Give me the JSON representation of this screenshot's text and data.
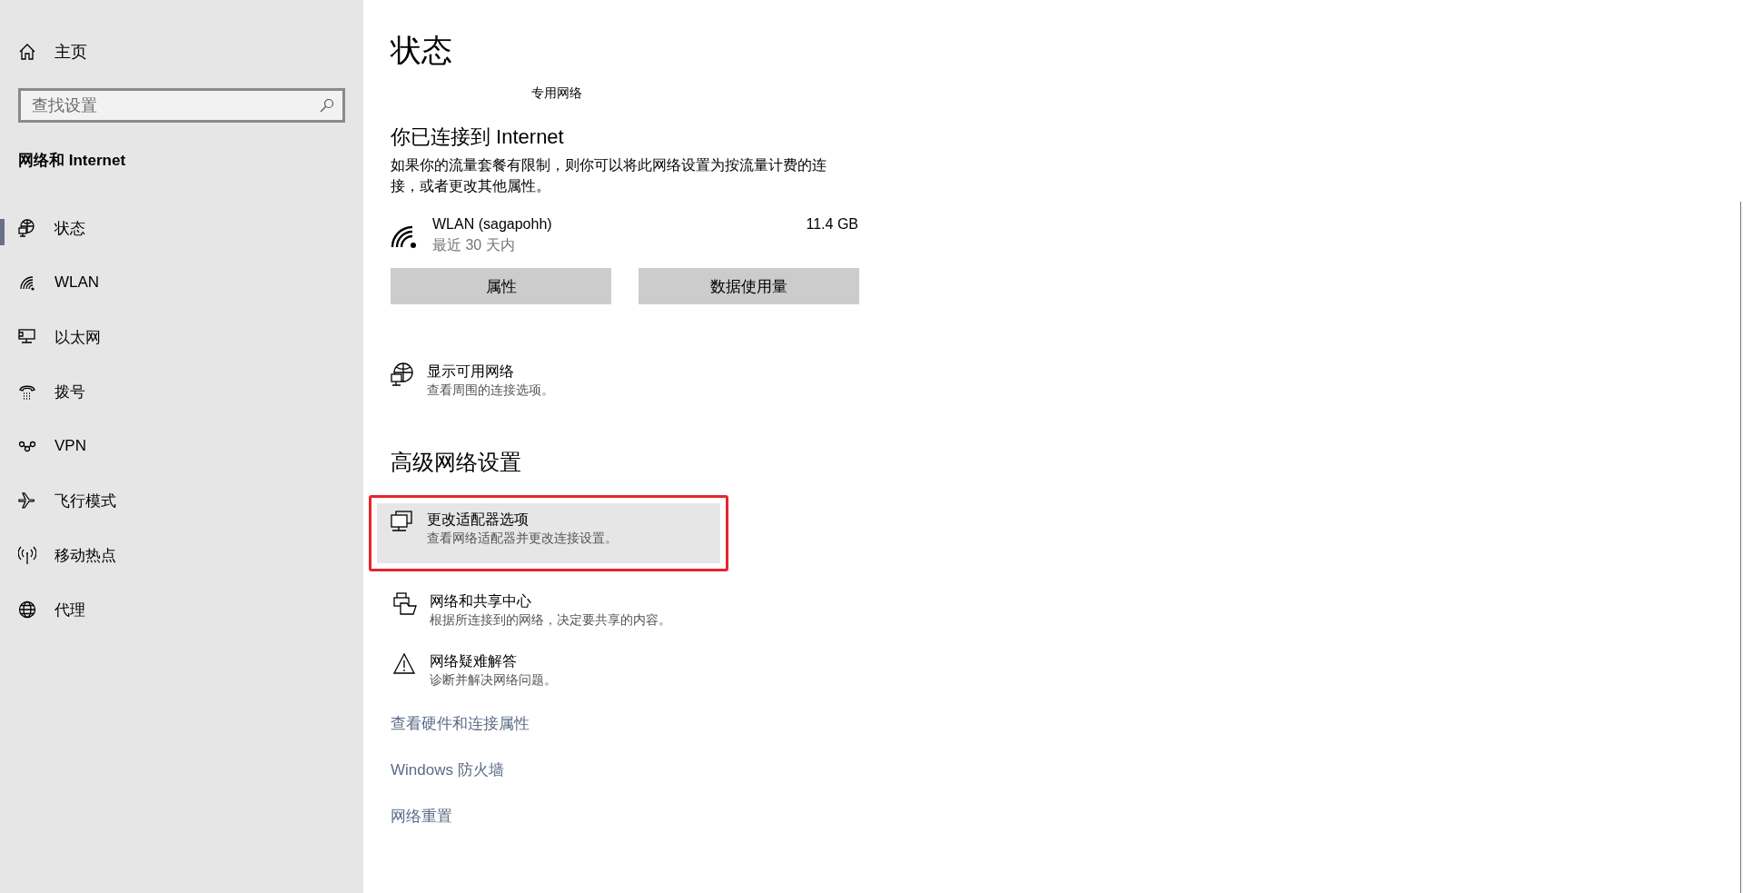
{
  "sidebar": {
    "home": "主页",
    "search": {
      "placeholder": "查找设置"
    },
    "section_title": "网络和 Internet",
    "items": [
      {
        "label": "状态",
        "selected": true
      },
      {
        "label": "WLAN",
        "selected": false
      },
      {
        "label": "以太网",
        "selected": false
      },
      {
        "label": "拨号",
        "selected": false
      },
      {
        "label": "VPN",
        "selected": false
      },
      {
        "label": "飞行模式",
        "selected": false
      },
      {
        "label": "移动热点",
        "selected": false
      },
      {
        "label": "代理",
        "selected": false
      }
    ]
  },
  "main": {
    "title": "状态",
    "network_profile": "专用网络",
    "connection_heading": "你已连接到 Internet",
    "connection_text": "如果你的流量套餐有限制，则你可以将此网络设置为按流量计费的连接，或者更改其他属性。",
    "adapter": {
      "name": "WLAN (sagapohh)",
      "period": "最近 30 天内",
      "usage": "11.4 GB"
    },
    "buttons": [
      "属性",
      "数据使用量"
    ],
    "show_networks": {
      "title": "显示可用网络",
      "description": "查看周围的连接选项。"
    },
    "advanced_heading": "高级网络设置",
    "advanced_items": [
      {
        "title": "更改适配器选项",
        "description": "查看网络适配器并更改连接设置。",
        "highlighted": true
      },
      {
        "title": "网络和共享中心",
        "description": "根据所连接到的网络，决定要共享的内容。",
        "highlighted": false
      },
      {
        "title": "网络疑难解答",
        "description": "诊断并解决网络问题。",
        "highlighted": false
      }
    ],
    "links": [
      "查看硬件和连接属性",
      "Windows 防火墙",
      "网络重置"
    ]
  }
}
